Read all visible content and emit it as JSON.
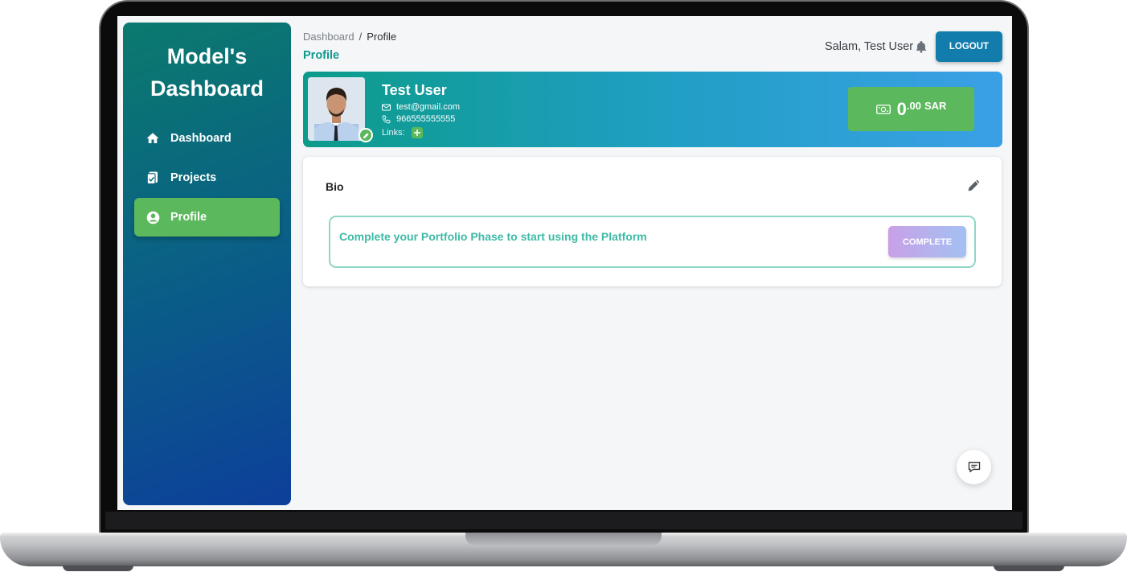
{
  "sidebar": {
    "brand_line1": "Model's",
    "brand_line2": "Dashboard",
    "items": [
      {
        "label": "Dashboard",
        "icon": "home-icon",
        "active": false
      },
      {
        "label": "Projects",
        "icon": "clipboard-icon",
        "active": false
      },
      {
        "label": "Profile",
        "icon": "user-circle-icon",
        "active": true
      }
    ]
  },
  "header": {
    "breadcrumb_root": "Dashboard",
    "breadcrumb_sep": "/",
    "breadcrumb_current": "Profile",
    "page_title": "Profile",
    "greeting": "Salam, Test User",
    "bell_icon": "bell-icon",
    "logout_label": "LOGOUT"
  },
  "profile": {
    "name": "Test User",
    "email": "test@gmail.com",
    "phone": "966555555555",
    "links_label": "Links:",
    "balance_integer": "0",
    "balance_decimal": ".00",
    "balance_currency": "SAR",
    "balance_icon": "money-icon"
  },
  "bio": {
    "title": "Bio",
    "notice_text": "Complete your Portfolio Phase to start using the Platform",
    "complete_label": "COMPLETE"
  },
  "colors": {
    "accent_green": "#5cb85c",
    "title_teal": "#11998e",
    "logout_blue": "#127cad"
  }
}
